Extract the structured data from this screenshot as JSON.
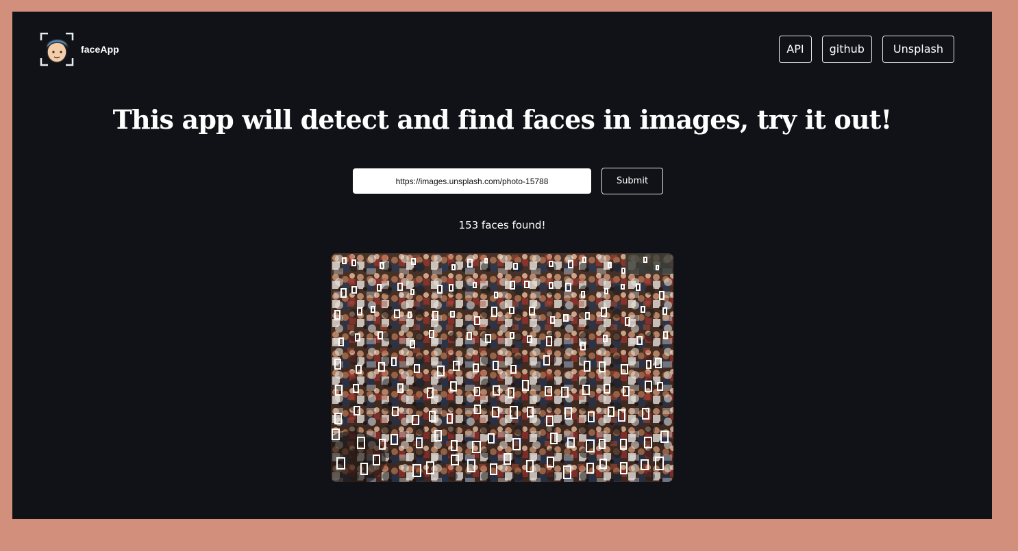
{
  "header": {
    "brand": "faceApp",
    "logo_icon": "face-scan-icon",
    "nav": [
      {
        "label": "API"
      },
      {
        "label": "github"
      },
      {
        "label": "Unsplash"
      }
    ]
  },
  "main": {
    "headline": "This app will detect and find faces in images, try it out!",
    "url_input": {
      "value": "https://images.unsplash.com/photo-15788"
    },
    "submit_label": "Submit",
    "result_text": "153 faces found!"
  },
  "colors": {
    "page_frame": "#d28f7b",
    "app_background": "#111217",
    "box_stroke": "#ffffff"
  }
}
